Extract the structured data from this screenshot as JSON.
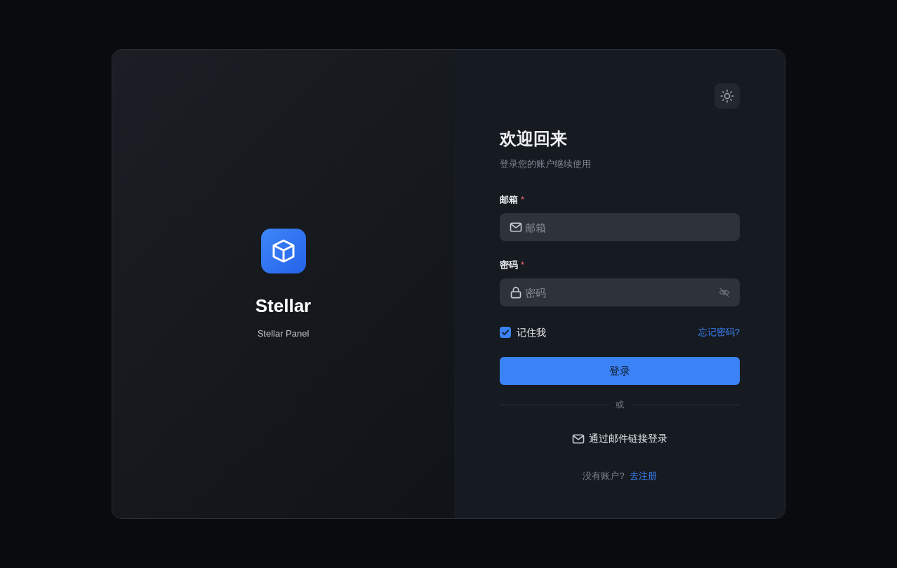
{
  "brand": {
    "name": "Stellar",
    "subtitle": "Stellar Panel"
  },
  "heading": "欢迎回来",
  "subheading": "登录您的账户继续使用",
  "fields": [
    {
      "kind": "email",
      "label": "邮箱",
      "required_mark": "*",
      "placeholder": "邮箱"
    },
    {
      "kind": "password",
      "label": "密码",
      "required_mark": "*",
      "placeholder": "密码",
      "revealed": false
    }
  ],
  "remember": {
    "label": "记住我",
    "checked": true
  },
  "forgot_link": "忘记密码?",
  "submit_button": "登录",
  "divider": "或",
  "email_link_button": "通过邮件链接登录",
  "register": {
    "prompt": "没有账户?",
    "link": "去注册"
  }
}
